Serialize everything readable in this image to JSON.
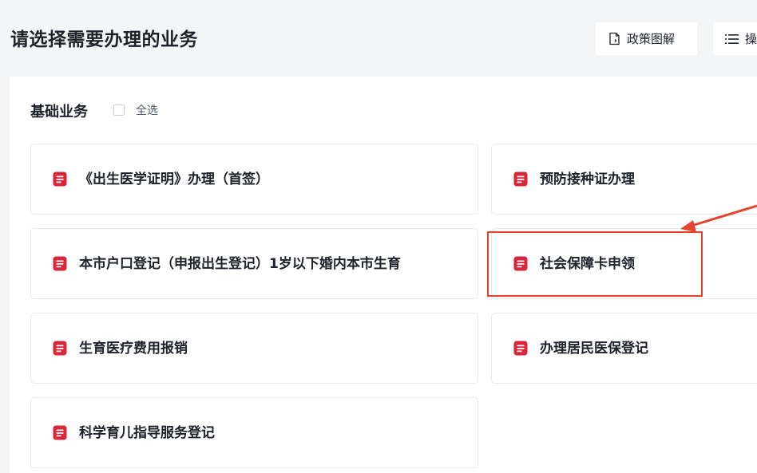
{
  "header": {
    "title": "请选择需要办理的业务",
    "policy_button": {
      "label": "政策图解",
      "icon": "document-icon"
    },
    "guide_button": {
      "label": "操",
      "icon": "list-icon"
    }
  },
  "section": {
    "title": "基础业务",
    "select_all_label": "全选",
    "select_all_checked": false
  },
  "services": [
    {
      "label": "《出生医学证明》办理（首签）",
      "icon": "document-icon"
    },
    {
      "label": "预防接种证办理",
      "icon": "document-icon"
    },
    {
      "label": "本市户口登记（申报出生登记）1岁以下婚内本市生育",
      "icon": "document-icon"
    },
    {
      "label": "社会保障卡申领",
      "icon": "document-icon",
      "highlighted": true
    },
    {
      "label": "生育医疗费用报销",
      "icon": "document-icon"
    },
    {
      "label": "办理居民医保登记",
      "icon": "document-icon"
    },
    {
      "label": "科学育儿指导服务登记",
      "icon": "document-icon"
    }
  ],
  "colors": {
    "icon_red": "#d9263a",
    "annotation_red": "#e8412e",
    "background": "#f4f5f7",
    "card_border": "#e8e9ec"
  }
}
